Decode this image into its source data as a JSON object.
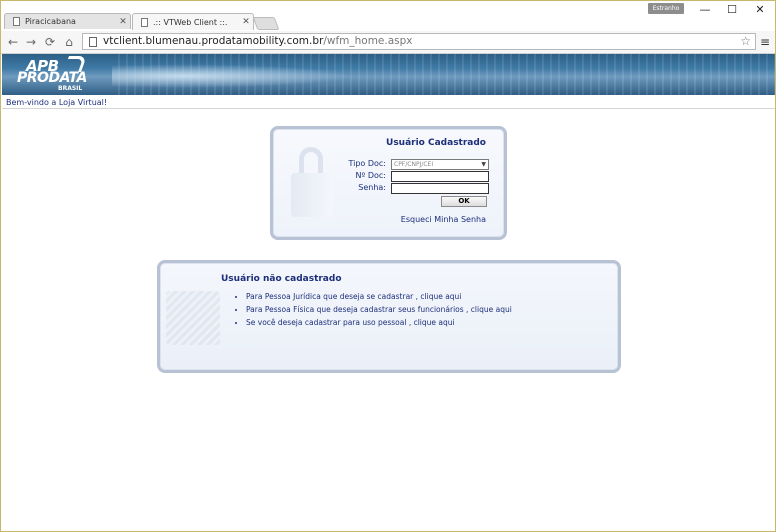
{
  "browser": {
    "tabs": [
      {
        "label": "Piracicabana",
        "active": false
      },
      {
        "label": ".:: VTWeb Client ::.",
        "active": true
      }
    ],
    "guest_badge": "Estranho",
    "window_controls": {
      "minimize": "—",
      "maximize": "☐",
      "close": "✕"
    },
    "url": {
      "host": "vtclient.blumenau.prodatamobility.com.br",
      "path": "/wfm_home.aspx"
    }
  },
  "banner": {
    "logo_line1": "APB",
    "logo_line2": "PRODATA",
    "logo_line3": "BRASIL"
  },
  "welcome_text": "Bem-vindo a Loja Virtual!",
  "login_box": {
    "title": "Usuário Cadastrado",
    "tipo_doc_label": "Tipo Doc:",
    "tipo_doc_value": "CPF/CNPJ/CEI",
    "num_doc_label": "Nº Doc:",
    "senha_label": "Senha:",
    "ok_label": "OK",
    "forgot_label": "Esqueci Minha Senha"
  },
  "register_box": {
    "title": "Usuário não cadastrado",
    "items": [
      "Para Pessoa Jurídica que deseja se cadastrar , clique aqui",
      "Para Pessoa Física que deseja cadastrar seus funcionários , clique aqui",
      "Se você deseja cadastrar para uso pessoal , clique aqui"
    ]
  },
  "colors": {
    "link_text": "#1d2f7a",
    "box_border": "#b7c2d4",
    "banner": "#2c5f86"
  }
}
